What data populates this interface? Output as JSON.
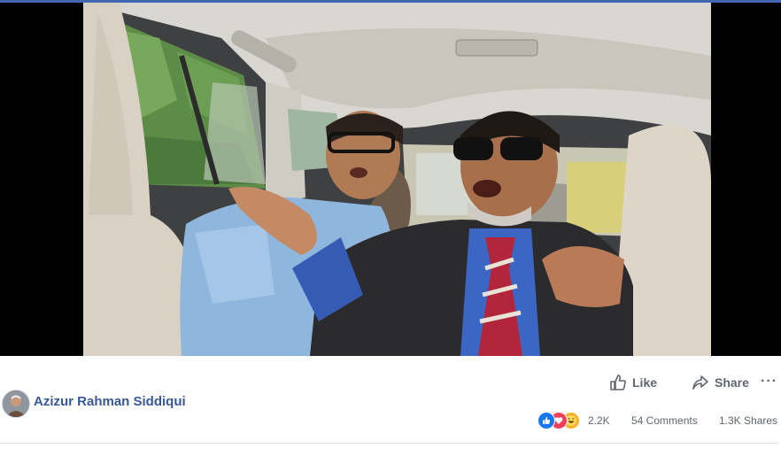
{
  "post": {
    "author_name": "Azizur Rahman Siddiqui",
    "avatar_icon": "profile-photo-icon"
  },
  "actions": {
    "like_label": "Like",
    "share_label": "Share",
    "more_label": "···"
  },
  "stats": {
    "reaction_count": "2.2K",
    "comments": "54 Comments",
    "shares": "1.3K Shares",
    "reaction_icons": [
      "like-reaction-icon",
      "love-reaction-icon",
      "haha-reaction-icon"
    ]
  },
  "colors": {
    "brand_blue": "#4267b2",
    "author_link": "#385898",
    "muted_text": "#606770"
  }
}
